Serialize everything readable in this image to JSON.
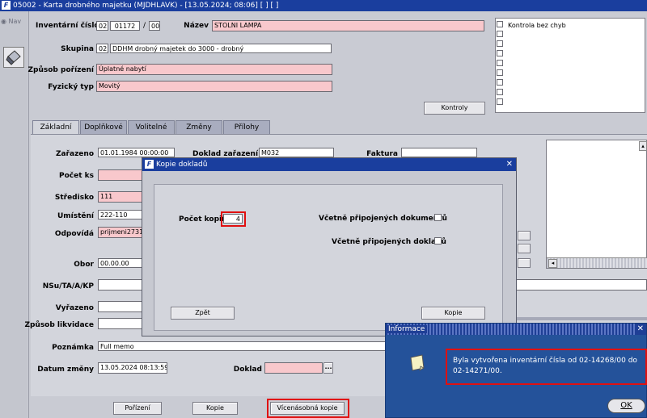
{
  "window": {
    "title": "05002 - Karta drobného majetku (MJDHLAVK) - [13.05.2024; 08:06] [ ] [ ]"
  },
  "side": {
    "nav": "Nav"
  },
  "header": {
    "inv_label": "Inventární číslo",
    "inv_part1": "02",
    "inv_part2": "01172",
    "inv_sep": "/",
    "inv_part3": "00",
    "nazev_label": "Název",
    "nazev_value": "STOLNI LAMPA",
    "skupina_label": "Skupina",
    "skupina_code": "02",
    "skupina_value": "DDHM drobný majetek do 3000 - drobný",
    "zpusob_label": "Způsob pořízení",
    "zpusob_value": "Úplatné nabytí",
    "fyzicky_label": "Fyzický typ",
    "fyzicky_value": "Movitý",
    "kontrola_label": "Kontrola bez chyb",
    "kontroly_button": "Kontroly"
  },
  "tabs": [
    {
      "label": "Základní"
    },
    {
      "label": "Doplňkové"
    },
    {
      "label": "Volitelné"
    },
    {
      "label": "Změny"
    },
    {
      "label": "Přílohy"
    }
  ],
  "form": {
    "zarazeno_label": "Zařazeno",
    "zarazeno_value": "01.01.1984 00:00:00",
    "doklad_zarazeni_label": "Doklad zařazení",
    "doklad_zarazeni_value": "M032",
    "faktura_label": "Faktura",
    "pocet_ks_label": "Počet ks",
    "stredisko_label": "Středisko",
    "stredisko_value": "111",
    "umisteni_label": "Umístění",
    "umisteni_value": "222-110",
    "odpovida_label": "Odpovídá",
    "odpovida_value": "prijmeni2731",
    "obor_label": "Obor",
    "obor_value": "00.00.00",
    "nsu_label": "NSu/TA/A/KP",
    "vyrazeno_label": "Vyřazeno",
    "zpusob_likvidace_label": "Způsob likvidace",
    "poznamka_label": "Poznámka",
    "poznamka_value": "Full memo",
    "datum_zmeny_label": "Datum změny",
    "datum_zmeny_value": "13.05.2024 08:13:59",
    "doklad_label": "Doklad",
    "lookup_button": "..."
  },
  "bottom_buttons": {
    "porizeni": "Pořízení",
    "kopie": "Kopie",
    "vicenasobna": "Vícenásobná kopie"
  },
  "dialog_kopie": {
    "title": "Kopie dokladů",
    "close": "✕",
    "pocet_kopii_label": "Počet kopií",
    "pocet_kopii_value": "4",
    "vcetne_dokumentu_label": "Včetně připojených dokumentů",
    "vcetne_dokladu_label": "Včetně připojených dokladů",
    "zpet_button": "Zpět",
    "kopie_button": "Kopie"
  },
  "dialog_info": {
    "title": "Informace",
    "close": "✕",
    "message": "Byla vytvořena inventární čísla od 02-14268/00 do 02-14271/00.",
    "ok_button": "OK"
  },
  "colors": {
    "title_blue": "#1a3e9e",
    "required_pink": "#f8c8cc",
    "highlight_red": "#e01010",
    "info_blue": "#24529a"
  }
}
